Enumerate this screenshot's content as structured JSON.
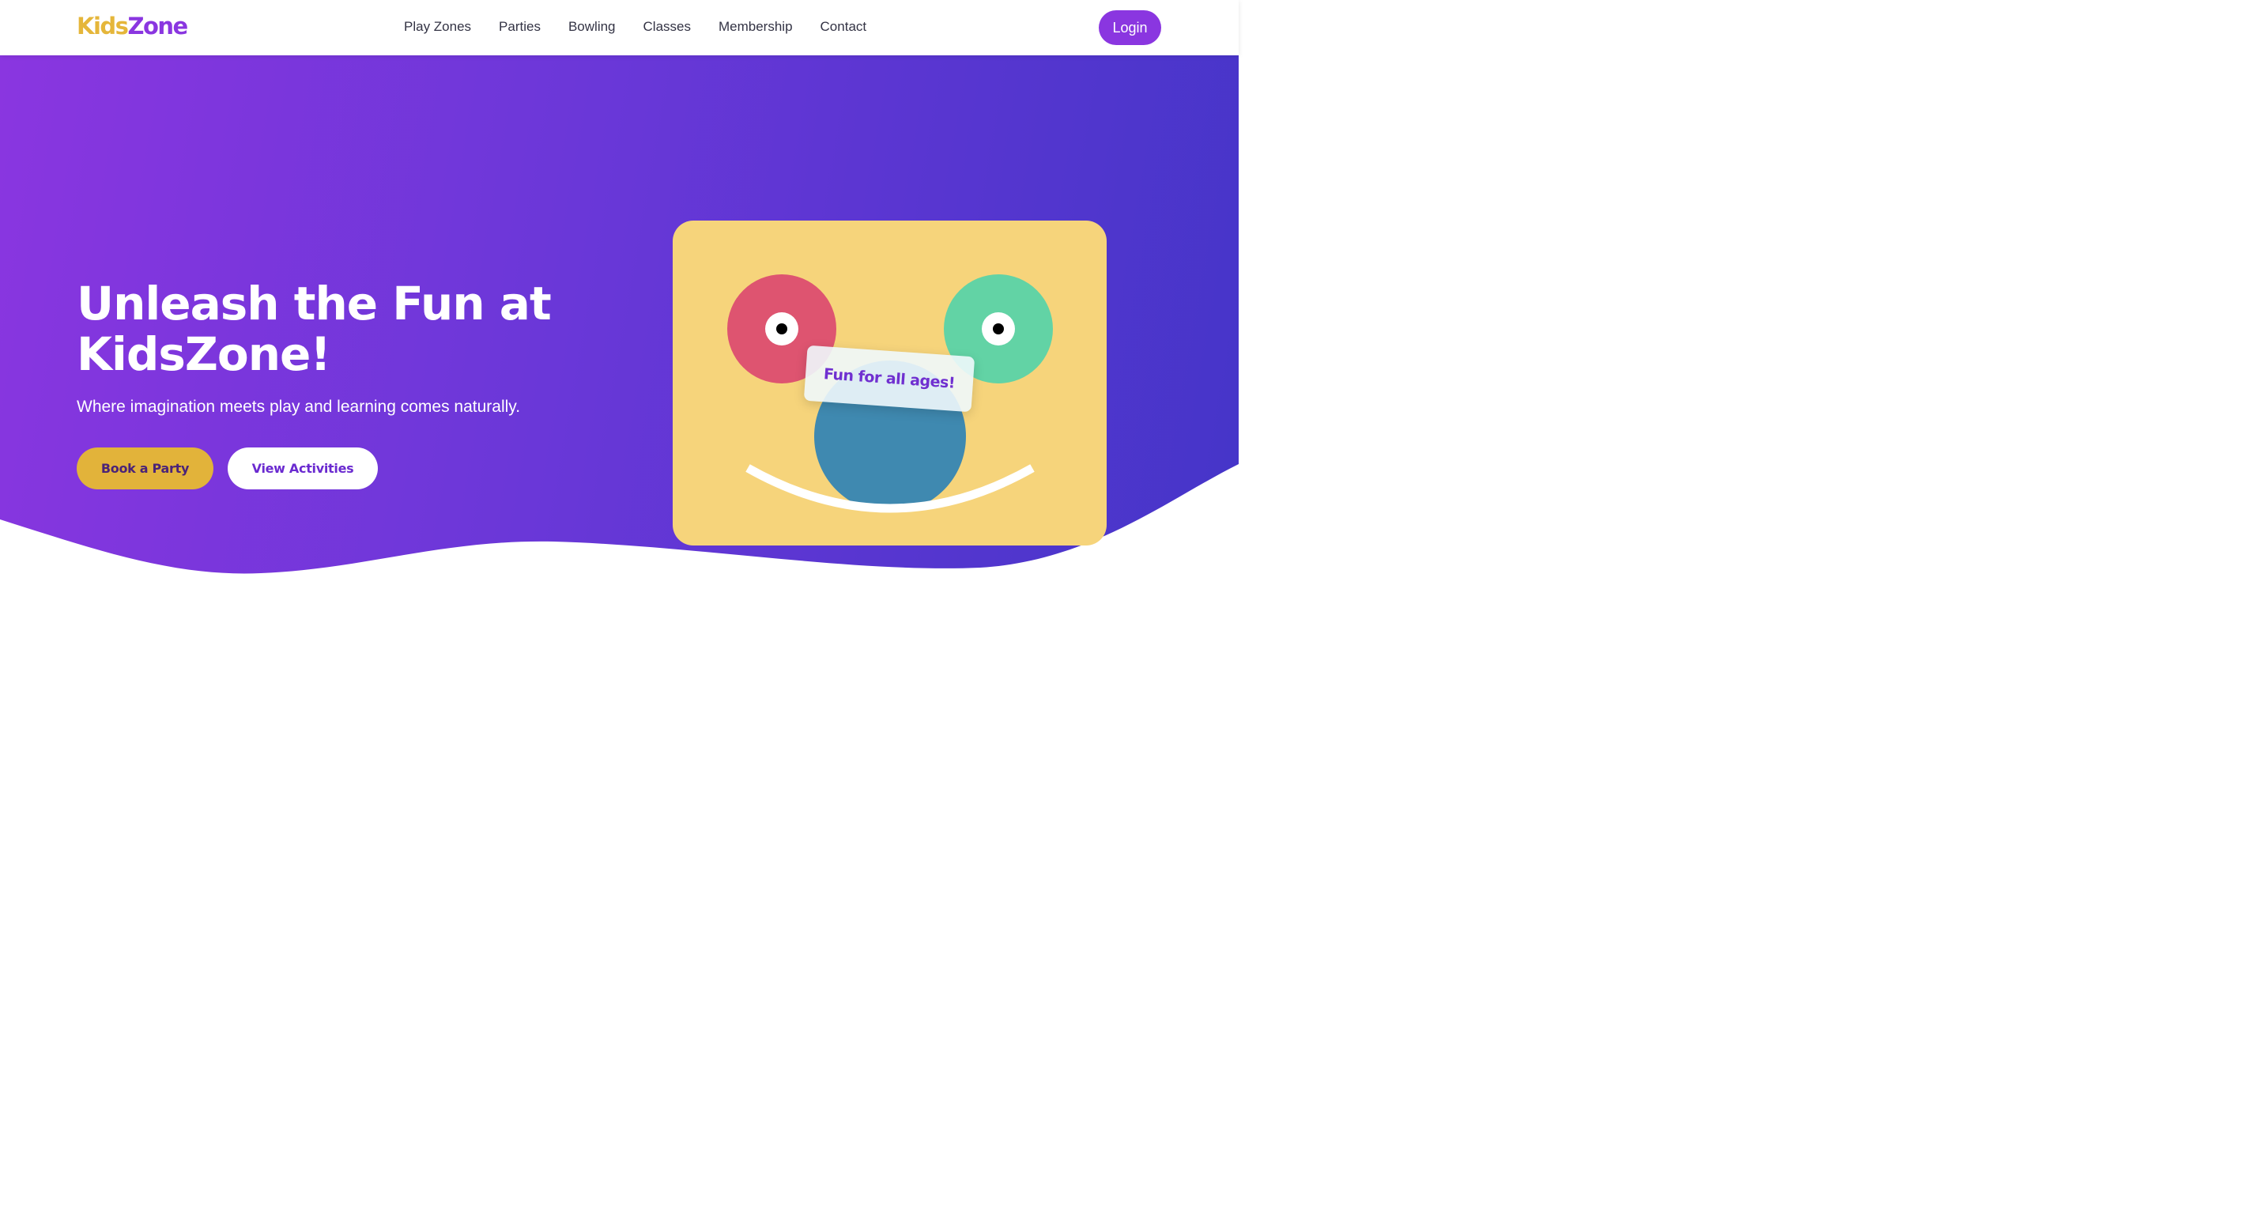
{
  "header": {
    "logo_part1": "Kids",
    "logo_part2": "Zone",
    "nav_items": [
      "Play Zones",
      "Parties",
      "Bowling",
      "Classes",
      "Membership",
      "Contact"
    ],
    "login_label": "Login"
  },
  "hero": {
    "headline_line1": "Unleash the Fun at",
    "headline_line2": "KidsZone!",
    "subtitle": "Where imagination meets play and learning comes naturally.",
    "primary_button": "Book a Party",
    "secondary_button": "View Activities",
    "illustration_tag": "Fun for all ages!"
  },
  "colors": {
    "brand_purple": "#8a36e0",
    "brand_yellow": "#e5b63a",
    "gradient_start": "#8a36e0",
    "gradient_end": "#4435c8",
    "illustration_bg": "#f6d47b",
    "circle_red": "#de5470",
    "circle_green": "#62d3a5",
    "circle_blue": "#3f89b0"
  }
}
